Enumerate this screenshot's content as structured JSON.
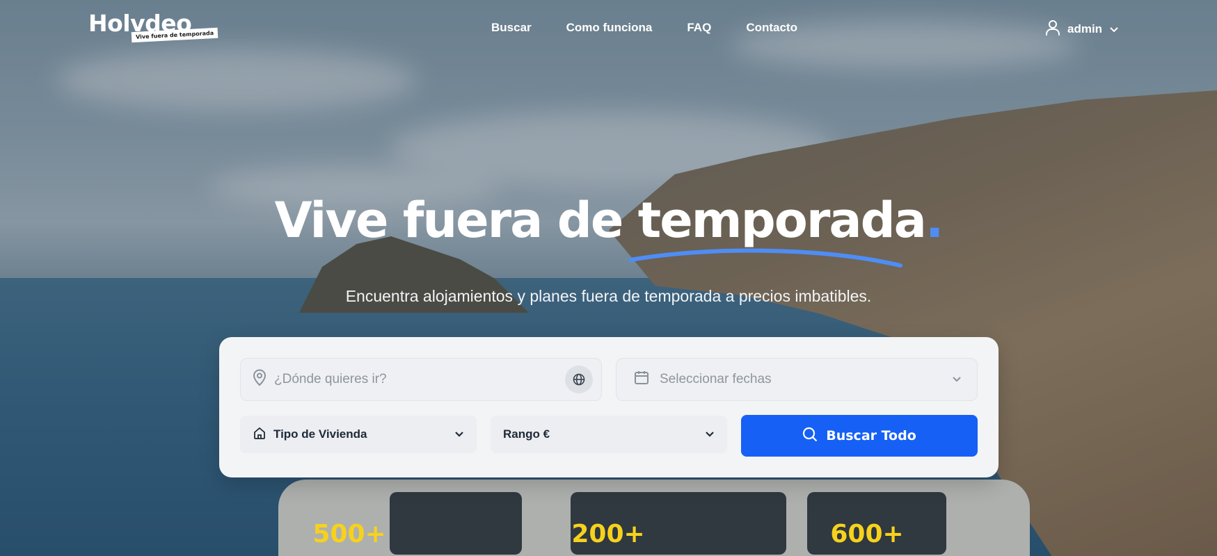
{
  "logo": {
    "word": "Holvdeo",
    "tagline": "Vive fuera de temporada"
  },
  "nav": {
    "items": [
      {
        "label": "Buscar"
      },
      {
        "label": "Como funciona"
      },
      {
        "label": "FAQ"
      },
      {
        "label": "Contacto"
      }
    ]
  },
  "user": {
    "name": "admin",
    "icon": "user-icon",
    "caret_icon": "chevron-down-icon"
  },
  "hero": {
    "title_main": "Vive fuera de temporada",
    "title_dot": ".",
    "subtitle": "Encuentra alojamientos y planes fuera de temporada a precios imbatibles."
  },
  "search": {
    "destination": {
      "placeholder": "¿Dónde quieres ir?",
      "value": "",
      "icon": "location-pin-icon",
      "action_icon": "globe-icon"
    },
    "dates": {
      "label": "Seleccionar fechas",
      "icon": "calendar-icon"
    },
    "housing_type": {
      "label": "Tipo de Vivienda",
      "icon": "home-icon"
    },
    "price_range": {
      "label": "Rango €"
    },
    "submit": {
      "label": "Buscar Todo",
      "icon": "search-icon"
    }
  },
  "stats": [
    {
      "value": "500+"
    },
    {
      "value": "200+"
    },
    {
      "value": "600+"
    }
  ],
  "colors": {
    "accent": "#1660f5",
    "highlight": "#4f8df5",
    "stat": "#f7d21c"
  }
}
